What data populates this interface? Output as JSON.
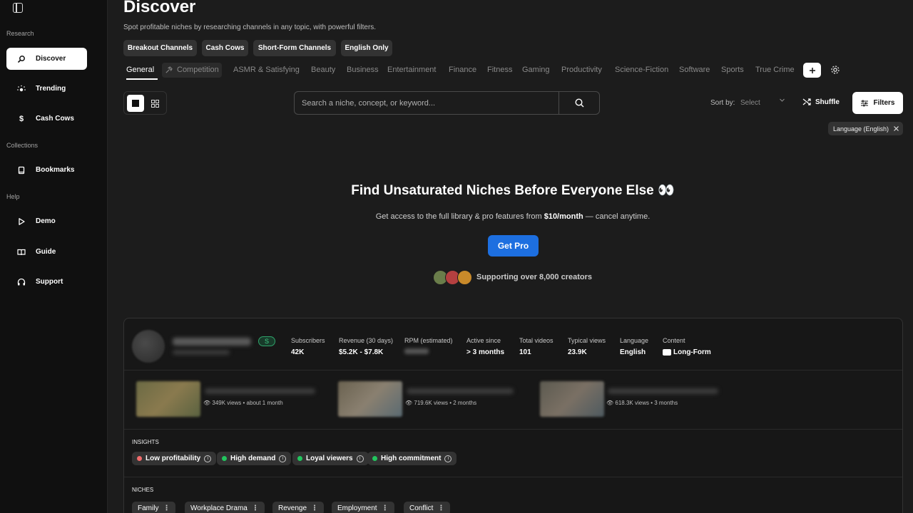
{
  "sidebar": {
    "sections": {
      "research": "Research",
      "collections": "Collections",
      "help": "Help"
    },
    "items": [
      {
        "label": "Discover"
      },
      {
        "label": "Trending"
      },
      {
        "label": "Cash Cows"
      },
      {
        "label": "Bookmarks"
      },
      {
        "label": "Demo"
      },
      {
        "label": "Guide"
      },
      {
        "label": "Support"
      }
    ],
    "cash_symbol": "$"
  },
  "header": {
    "title": "Discover",
    "subtitle": "Spot profitable niches by researching channels in any topic, with powerful filters."
  },
  "presets": [
    "Breakout Channels",
    "Cash Cows",
    "Short-Form Channels",
    "English Only"
  ],
  "categories": [
    "General",
    "Competition",
    "ASMR & Satisfying",
    "Beauty",
    "Business",
    "Entertainment",
    "Finance",
    "Fitness",
    "Gaming",
    "Productivity",
    "Science-Fiction",
    "Software",
    "Sports",
    "True Crime"
  ],
  "toolbar": {
    "search_placeholder": "Search a niche, concept, or keyword...",
    "sort_label": "Sort by:",
    "sort_value": "Select",
    "shuffle_label": "Shuffle",
    "filters_label": "Filters",
    "active_filter": "Language (English)"
  },
  "promo": {
    "title": "Find Unsaturated Niches Before Everyone Else",
    "title_emoji": "👀",
    "subtitle_pre": "Get access to the full library & pro features from ",
    "subtitle_price": "$10/month",
    "subtitle_post": " — cancel anytime.",
    "cta": "Get Pro",
    "social_proof": "Supporting over 8,000 creators"
  },
  "card": {
    "badge": "S",
    "stats": [
      {
        "label": "Subscribers",
        "value": "42K"
      },
      {
        "label": "Revenue (30 days)",
        "value": "$5.2K - $7.8K"
      },
      {
        "label": "RPM (estimated)",
        "value": ""
      },
      {
        "label": "Active since",
        "value": "> 3 months"
      },
      {
        "label": "Total videos",
        "value": "101"
      },
      {
        "label": "Typical views",
        "value": "23.9K"
      },
      {
        "label": "Language",
        "value": "English"
      },
      {
        "label": "Content",
        "value": "Long-Form"
      }
    ],
    "videos": [
      {
        "meta": "349K views • about 1 month"
      },
      {
        "meta": "719.6K views • 2 months"
      },
      {
        "meta": "618.3K views • 3 months"
      }
    ],
    "insights_label": "INSIGHTS",
    "insights": [
      {
        "label": "Low profitability",
        "color": "#f06b6b"
      },
      {
        "label": "High demand",
        "color": "#22c55e"
      },
      {
        "label": "Loyal viewers",
        "color": "#22c55e"
      },
      {
        "label": "High commitment",
        "color": "#22c55e"
      }
    ],
    "niches_label": "NICHES",
    "niches": [
      "Family",
      "Workplace Drama",
      "Revenge",
      "Employment",
      "Conflict"
    ]
  }
}
